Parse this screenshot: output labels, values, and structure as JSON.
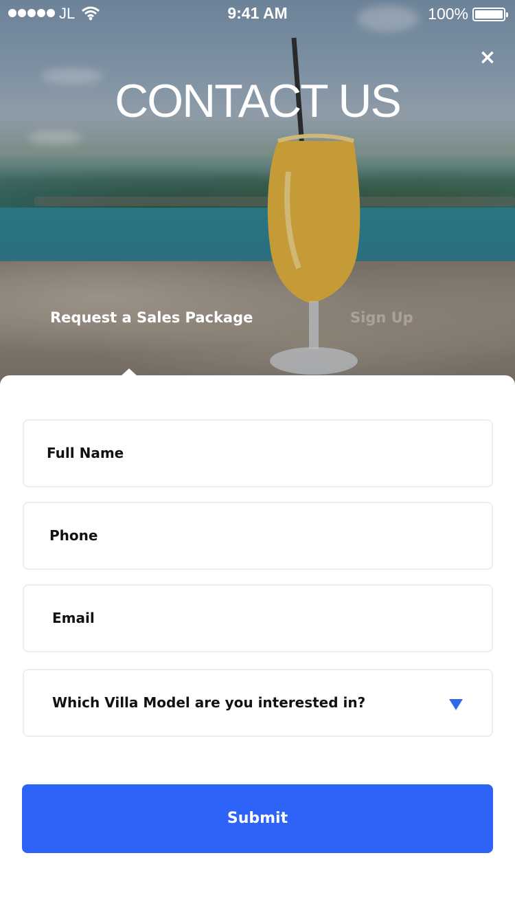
{
  "status_bar": {
    "carrier": "JL",
    "time": "9:41 AM",
    "battery_percent": "100%",
    "battery_level": 1.0,
    "wifi_icon": "wifi-icon",
    "signal_icon": "signal-dots-icon",
    "battery_icon": "battery-icon"
  },
  "header": {
    "title": "CONTACT US",
    "close_icon": "close-icon",
    "close_label": "×"
  },
  "tabs": [
    {
      "label": "Request a Sales Package",
      "active": true
    },
    {
      "label": "Sign Up",
      "active": false
    }
  ],
  "form": {
    "full_name_label": "Full Name",
    "phone_label": "Phone",
    "email_label": "Email",
    "villa_select_label": "Which Villa Model are you interested in?",
    "dropdown_icon": "triangle-down-icon",
    "submit_label": "Submit"
  },
  "colors": {
    "accent": "#2d63f6",
    "dropdown_arrow": "#2f68e8",
    "field_border": "#eeeeee",
    "text": "#111111"
  }
}
